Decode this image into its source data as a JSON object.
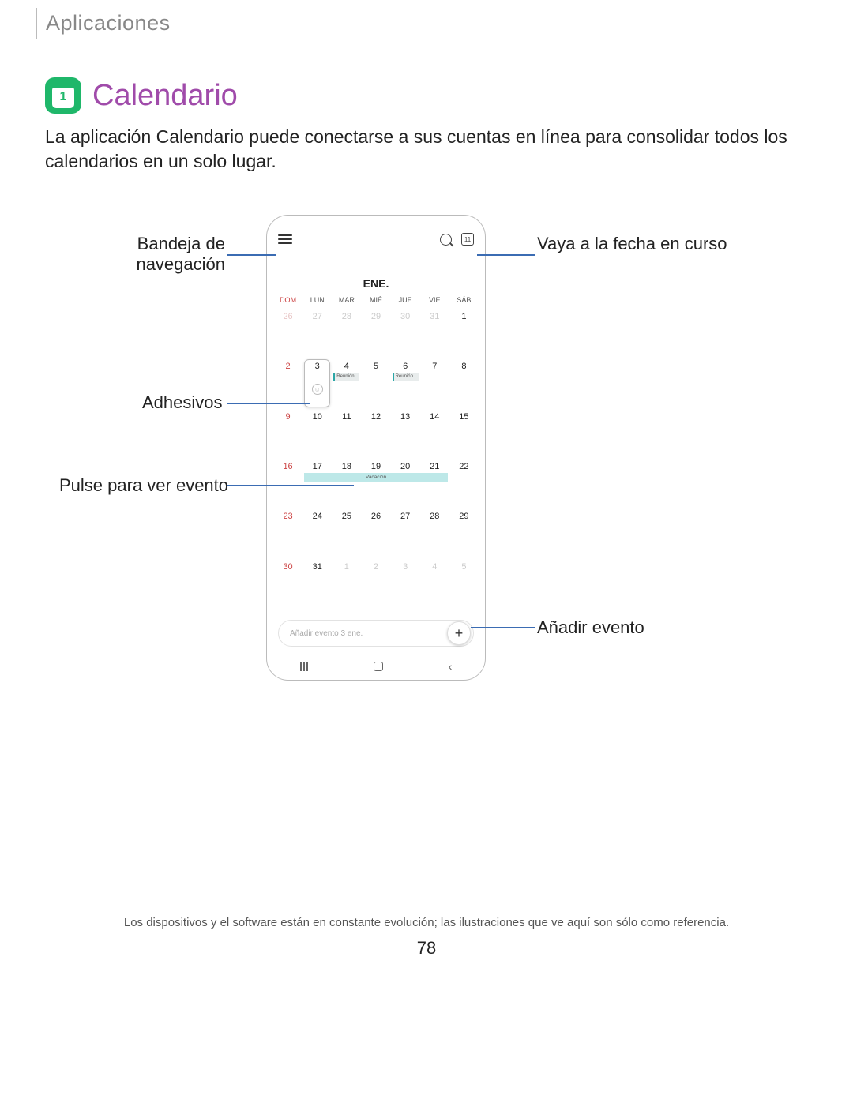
{
  "header": {
    "section_label": "Aplicaciones"
  },
  "title": {
    "icon_day": "1",
    "text": "Calendario"
  },
  "intro": "La aplicación Calendario puede conectarse a sus cuentas en línea para consolidar todos los calendarios en un solo lugar.",
  "phone": {
    "month": "ENE.",
    "date_icon_day": "11",
    "weekdays": [
      "DOM",
      "LUN",
      "MAR",
      "MIÉ",
      "JUE",
      "VIE",
      "SÁB"
    ],
    "rows": [
      [
        {
          "n": "26",
          "other": true,
          "sun": true
        },
        {
          "n": "27",
          "other": true
        },
        {
          "n": "28",
          "other": true
        },
        {
          "n": "29",
          "other": true
        },
        {
          "n": "30",
          "other": true
        },
        {
          "n": "31",
          "other": true
        },
        {
          "n": "1"
        }
      ],
      [
        {
          "n": "2",
          "sun": true
        },
        {
          "n": "3",
          "selected": true,
          "sticker": true
        },
        {
          "n": "4",
          "event": "Reunión"
        },
        {
          "n": "5"
        },
        {
          "n": "6",
          "event": "Reunión"
        },
        {
          "n": "7"
        },
        {
          "n": "8"
        }
      ],
      [
        {
          "n": "9",
          "sun": true
        },
        {
          "n": "10"
        },
        {
          "n": "11"
        },
        {
          "n": "12"
        },
        {
          "n": "13"
        },
        {
          "n": "14"
        },
        {
          "n": "15"
        }
      ],
      [
        {
          "n": "16",
          "sun": true
        },
        {
          "n": "17",
          "vac_start": true
        },
        {
          "n": "18"
        },
        {
          "n": "19",
          "vac_label": "Vacación"
        },
        {
          "n": "20"
        },
        {
          "n": "21",
          "vac_end": true
        },
        {
          "n": "22"
        }
      ],
      [
        {
          "n": "23",
          "sun": true
        },
        {
          "n": "24"
        },
        {
          "n": "25"
        },
        {
          "n": "26"
        },
        {
          "n": "27"
        },
        {
          "n": "28"
        },
        {
          "n": "29"
        }
      ],
      [
        {
          "n": "30",
          "sun": true
        },
        {
          "n": "31"
        },
        {
          "n": "1",
          "other": true
        },
        {
          "n": "2",
          "other": true
        },
        {
          "n": "3",
          "other": true
        },
        {
          "n": "4",
          "other": true
        },
        {
          "n": "5",
          "other": true
        }
      ]
    ],
    "add_event_placeholder": "Añadir evento 3 ene.",
    "vac_label": "Vacación"
  },
  "callouts": {
    "nav_drawer": "Bandeja de navegación",
    "go_today": "Vaya a la fecha en curso",
    "stickers": "Adhesivos",
    "tap_event": "Pulse para ver evento",
    "add_event": "Añadir evento"
  },
  "footer_note": "Los dispositivos y el software están en constante evolución; las ilustraciones que ve aquí son sólo como referencia.",
  "page_number": "78"
}
